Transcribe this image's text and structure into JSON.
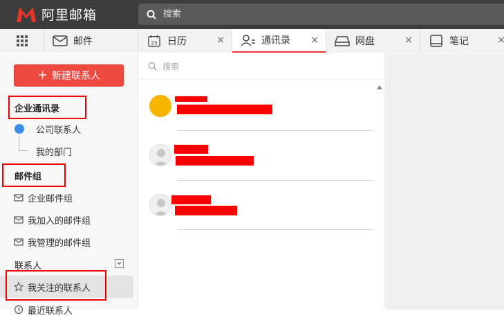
{
  "app": {
    "title": "阿里邮箱"
  },
  "search": {
    "placeholder": "搜索"
  },
  "tabs": [
    {
      "label": "邮件",
      "icon": "mail-icon"
    },
    {
      "label": "日历",
      "icon": "calendar-icon",
      "date": "25"
    },
    {
      "label": "通讯录",
      "icon": "contacts-icon",
      "active": true
    },
    {
      "label": "网盘",
      "icon": "drive-icon"
    },
    {
      "label": "笔记",
      "icon": "notes-icon"
    }
  ],
  "sidebar": {
    "new_contact": "新建联系人",
    "enterprise_title": "企业通讯录",
    "company_contacts": "公司联系人",
    "my_department": "我的部门",
    "group_title": "邮件组",
    "enterprise_groups": "企业邮件组",
    "joined_groups": "我加入的邮件组",
    "managed_groups": "我管理的邮件组",
    "contacts_title": "联系人",
    "followed_contacts": "我关注的联系人",
    "recent_contacts": "最近联系人"
  },
  "list": {
    "search_placeholder": "搜索"
  },
  "colors": {
    "accent": "#ef4a41",
    "topbar": "#3c3c3c",
    "highlight_box": "#ee0000",
    "avatar_orange": "#f5b400"
  }
}
